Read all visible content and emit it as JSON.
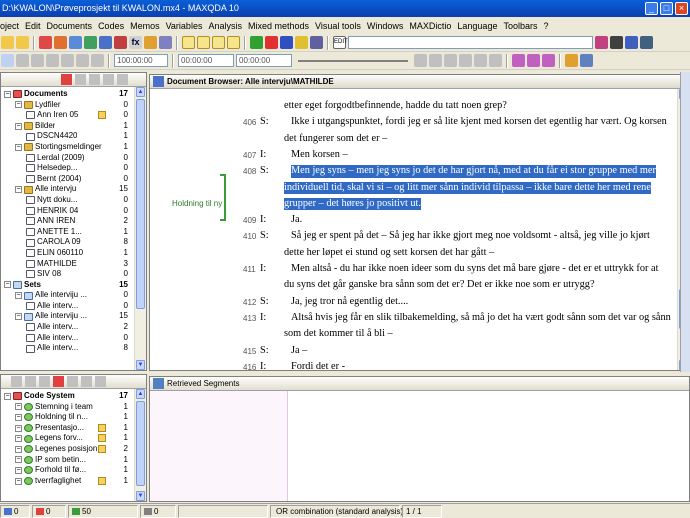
{
  "window": {
    "title": "D:\\KWALON\\Prøveprosjekt til KWALON.mx4 - MAXQDA 10"
  },
  "menu": [
    "oject",
    "Edit",
    "Documents",
    "Codes",
    "Memos",
    "Variables",
    "Analysis",
    "Mixed methods",
    "Visual tools",
    "Windows",
    "MAXDictio",
    "Language",
    "Toolbars",
    "?"
  ],
  "toolbar": {
    "weight_filter": "100:00:00",
    "time_start": "00:00:00",
    "time_end": "00:00:00"
  },
  "document_system": {
    "items": [
      {
        "label": "Documents",
        "count": "17",
        "level": 0,
        "icon": "root",
        "bold": true
      },
      {
        "label": "Lydfiler",
        "count": "0",
        "level": 1,
        "icon": "folder"
      },
      {
        "label": "Ann Iren 05",
        "count": "0",
        "level": 2,
        "icon": "doc",
        "memo": true
      },
      {
        "label": "Bilder",
        "count": "1",
        "level": 1,
        "icon": "folder"
      },
      {
        "label": "DSCN4420",
        "count": "1",
        "level": 2,
        "icon": "doc"
      },
      {
        "label": "Stortingsmeldinger",
        "count": "1",
        "level": 1,
        "icon": "folder"
      },
      {
        "label": "Lerdal (2009)",
        "count": "0",
        "level": 2,
        "icon": "doc"
      },
      {
        "label": "Helsedep...",
        "count": "0",
        "level": 2,
        "icon": "doc"
      },
      {
        "label": "Bernt (2004)",
        "count": "0",
        "level": 2,
        "icon": "doc"
      },
      {
        "label": "Alle intervju",
        "count": "15",
        "level": 1,
        "icon": "folder"
      },
      {
        "label": "Nytt doku...",
        "count": "0",
        "level": 2,
        "icon": "doc"
      },
      {
        "label": "HENRIK 04",
        "count": "0",
        "level": 2,
        "icon": "doc"
      },
      {
        "label": "ANN IREN",
        "count": "2",
        "level": 2,
        "icon": "doc"
      },
      {
        "label": "ANETTE 1...",
        "count": "1",
        "level": 2,
        "icon": "doc"
      },
      {
        "label": "CAROLA  09",
        "count": "8",
        "level": 2,
        "icon": "doc"
      },
      {
        "label": "ELIN 060110",
        "count": "1",
        "level": 2,
        "icon": "doc"
      },
      {
        "label": "MATHILDE",
        "count": "3",
        "level": 2,
        "icon": "doc"
      },
      {
        "label": "SIV 08",
        "count": "0",
        "level": 2,
        "icon": "doc"
      },
      {
        "label": "Sets",
        "count": "15",
        "level": 0,
        "icon": "set",
        "bold": true
      },
      {
        "label": "Alle interviju ...",
        "count": "0",
        "level": 1,
        "icon": "set"
      },
      {
        "label": "Alle interv...",
        "count": "0",
        "level": 2,
        "icon": "doc"
      },
      {
        "label": "Alle interviju ...",
        "count": "15",
        "level": 1,
        "icon": "set"
      },
      {
        "label": "Alle interv...",
        "count": "2",
        "level": 2,
        "icon": "doc"
      },
      {
        "label": "Alle interv...",
        "count": "0",
        "level": 2,
        "icon": "doc"
      },
      {
        "label": "Alle interv...",
        "count": "8",
        "level": 2,
        "icon": "doc"
      }
    ]
  },
  "code_system": {
    "items": [
      {
        "label": "Code System",
        "count": "17",
        "level": 0,
        "icon": "root",
        "bold": true
      },
      {
        "label": "Stemning i team",
        "count": "1",
        "level": 1,
        "icon": "code"
      },
      {
        "label": "Holdning til n...",
        "count": "1",
        "level": 1,
        "icon": "code"
      },
      {
        "label": "Presentasjo...",
        "count": "1",
        "level": 1,
        "icon": "code",
        "memo": true
      },
      {
        "label": "Legens forv...",
        "count": "1",
        "level": 1,
        "icon": "code",
        "memo": true
      },
      {
        "label": "Legenes posisjon",
        "count": "2",
        "level": 1,
        "icon": "code",
        "memo": true
      },
      {
        "label": "IP som betin...",
        "count": "1",
        "level": 1,
        "icon": "code"
      },
      {
        "label": "Forhold til fø...",
        "count": "1",
        "level": 1,
        "icon": "code"
      },
      {
        "label": "tverrfaglighet",
        "count": "1",
        "level": 1,
        "icon": "code",
        "memo": true
      }
    ]
  },
  "document_browser": {
    "title": "Document Browser: Alle intervju\\MATHILDE",
    "code_label": "Holdning til ny",
    "lines": [
      {
        "num": "",
        "spk": "",
        "text": "etter eget forgodtbefinnende, hadde du tatt noen grep?",
        "hl": false
      },
      {
        "num": "406",
        "spk": "S:",
        "text": "Ikke i utgangspunktet, fordi jeg er så lite kjent med korsen det egentlig har vært. Og korsen",
        "hl": false
      },
      {
        "num": "",
        "spk": "",
        "text": "det fungerer som det er –",
        "hl": false
      },
      {
        "num": "407",
        "spk": "I:",
        "text": "Men korsen –",
        "hl": false
      },
      {
        "num": "408",
        "spk": "S:",
        "text": "Men jeg syns – men jeg syns jo det de har gjort nå, med at du får ei stor gruppe med mer",
        "hl": true
      },
      {
        "num": "",
        "spk": "",
        "text": "individuell tid, skal vi si – og litt mer sånn individ tilpassa – ikke bare dette her med rene",
        "hl": true
      },
      {
        "num": "",
        "spk": "",
        "text": "grupper – det høres jo positivt ut.",
        "hl": true
      },
      {
        "num": "409",
        "spk": "I:",
        "text": "Ja.",
        "hl": false
      },
      {
        "num": "410",
        "spk": "S:",
        "text": "Så jeg er spent på det – Så jeg har ikke gjort meg noe voldsomt - altså, jeg ville jo kjørt",
        "hl": false
      },
      {
        "num": "",
        "spk": "",
        "text": "dette her løpet ei stund og sett korsen det har gått –",
        "hl": false
      },
      {
        "num": "411",
        "spk": "I:",
        "text": "Men altså  - du har ikke noen ideer som du syns det må bare gjøre - det er et uttrykk for at",
        "hl": false
      },
      {
        "num": "",
        "spk": "",
        "text": "du syns det går ganske bra sånn som det er? Det er ikke noe som er utrygg?",
        "hl": false
      },
      {
        "num": "412",
        "spk": "S:",
        "text": "Ja, jeg tror nå egentlig det....",
        "hl": false
      },
      {
        "num": "413",
        "spk": "I:",
        "text": "Altså hvis jeg får en slik tilbakemelding, så må jo det ha vært godt sånn som det var og sånn",
        "hl": false
      },
      {
        "num": "",
        "spk": "",
        "text": "som det kommer til å bli –",
        "hl": false
      },
      {
        "num": "415",
        "spk": "S:",
        "text": "Ja –",
        "hl": false
      },
      {
        "num": "416",
        "spk": "I:",
        "text": "Fordi det er -",
        "hl": false
      }
    ]
  },
  "retrieved_segments": {
    "title": "Retrieved Segments"
  },
  "status": {
    "docs": "0",
    "codes": "0",
    "segments": "50",
    "weight": "0",
    "mode": "OR combination (standard analysis)",
    "page": "1 / 1"
  },
  "colors": {
    "highlight": "#316ac5",
    "code_bracket": "#3a9c3a"
  }
}
